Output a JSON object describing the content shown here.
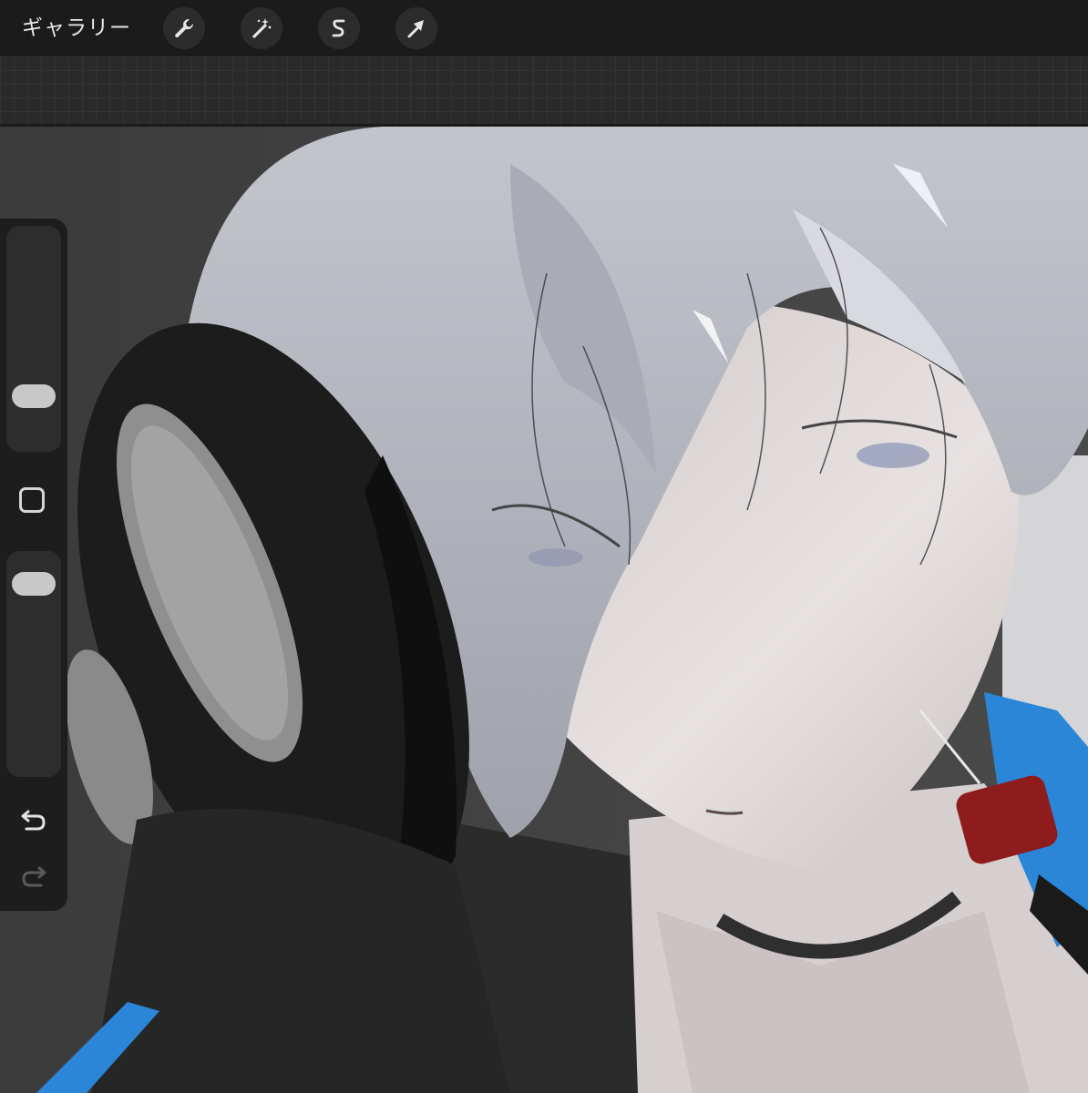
{
  "topbar": {
    "gallery_label": "ギャラリー",
    "tools": [
      {
        "icon": "wrench-icon",
        "name": "actions"
      },
      {
        "icon": "magic-wand-icon",
        "name": "adjustments"
      },
      {
        "icon": "selection-s-icon",
        "name": "selection"
      },
      {
        "icon": "arrow-cursor-icon",
        "name": "transform"
      }
    ]
  },
  "sidebar": {
    "brush_size": 0.2,
    "opacity": 0.92,
    "modify_icon": "square-icon",
    "undo_icon": "undo-arrow-icon",
    "redo_icon": "redo-arrow-icon"
  },
  "colors": {
    "toolbar_bg": "#1b1b1b",
    "sidebar_bg": "#1d1d1d",
    "hair": "#b3b6bf",
    "skin": "#d8d0cf",
    "headphone": "#1c1c1c",
    "blue_accent": "#2b86d8",
    "red_accent": "#8e1c1c"
  }
}
